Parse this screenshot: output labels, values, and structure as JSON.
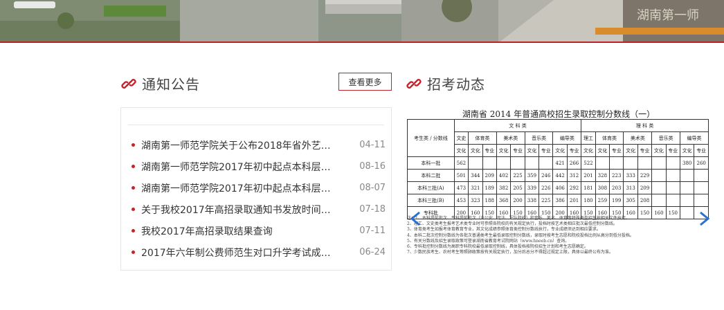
{
  "banner": {
    "sign_text": "湖南第一师"
  },
  "notice": {
    "title": "通知公告",
    "more_label": "查看更多",
    "items": [
      {
        "text": "湖南第一师范学院关于公布2018年省外艺术...",
        "date": "04-11"
      },
      {
        "text": "湖南第一师范学院2017年初中起点本科层次...",
        "date": "08-16"
      },
      {
        "text": "湖南第一师范学院2017年初中起点本科层次...",
        "date": "08-07"
      },
      {
        "text": "关于我校2017年高招录取通知书发放时间的...",
        "date": "07-18"
      },
      {
        "text": "我校2017年高招录取结果查询",
        "date": "07-11"
      },
      {
        "text": "2017年六年制公费师范生对口升学考试成绩...",
        "date": "06-24"
      }
    ]
  },
  "news": {
    "title": "招考动态",
    "slide": {
      "title": "湖南省 2014 年普通高校招生录取控制分数线（一）",
      "h_cat": "考生类",
      "h_line": "分数线",
      "h_batch": "批次",
      "h_wenke": "文 科 类",
      "h_like": "理 科 类",
      "sub_groups": [
        "文史",
        "体育类",
        "美术类",
        "音乐类",
        "编导类",
        "理工",
        "体育类",
        "美术类",
        "音乐类",
        "编导类"
      ],
      "sub_cols": [
        "文化",
        "文化",
        "专业",
        "文化",
        "专业",
        "文化",
        "专业",
        "文化",
        "专业",
        "文化",
        "文化",
        "专业",
        "文化",
        "专业",
        "文化",
        "专业",
        "文化",
        "专业"
      ],
      "rows": [
        {
          "label": "本科一批",
          "cells": [
            "562",
            "",
            "",
            "",
            "",
            "",
            "",
            "421",
            "266",
            "522",
            "",
            "",
            "",
            "",
            "",
            "",
            "380",
            "260"
          ]
        },
        {
          "label": "本科二批",
          "cells": [
            "501",
            "344",
            "209",
            "402",
            "225",
            "359",
            "246",
            "442",
            "312",
            "201",
            "328",
            "223",
            "333",
            "229",
            "",
            "",
            "",
            ""
          ]
        },
        {
          "label": "本科三批(A)",
          "cells": [
            "473",
            "321",
            "189",
            "382",
            "205",
            "339",
            "226",
            "406",
            "292",
            "181",
            "308",
            "203",
            "313",
            "209",
            "",
            "",
            "",
            ""
          ]
        },
        {
          "label": "本科三批(B)",
          "cells": [
            "453",
            "323",
            "188",
            "368",
            "200",
            "338",
            "225",
            "386",
            "201",
            "180",
            "259",
            "199",
            "305",
            "208",
            "",
            "",
            "",
            ""
          ]
        },
        {
          "label": "专科批",
          "cells": [
            "200",
            "160",
            "150",
            "160",
            "150",
            "160",
            "150",
            "200",
            "160",
            "150",
            "160",
            "150",
            "160",
            "150",
            "160",
            "150",
            "",
            ""
          ]
        }
      ],
      "notes": [
        "注：1、本科提前批次、专科提前批次（含公安、司法、军队院校）和音乐、美术、体育等特殊类型招生按相关文件执行。",
        "2、理工、文史类考生报考艺术类专业时可参照各院校的有关规定执行，投档时按艺术类相应批次最低控制分数线。",
        "3、体育类考生如报考体育教育专业，其文化成绩参照体育类控制分数线执行，专业成绩须达到相应要求。",
        "4、本科二批次控制分数线为各批次普通类考生最低录取控制分数线，录取时按考生志愿和院校投档比例从高分到低分投档。",
        "5、有关分数线及招生录取政策可登录湖南省教育考试院网站（www.hneeb.cn）查询。",
        "6、专科批控制分数线为高职专科院校最低录取控制线，具体投档按院校招生计划和考生志愿确定。",
        "7、少数民族考生、农村考生等照顾政策按有关规定执行，加分后总分不得超过规定上限，具体以最终公布为准。"
      ]
    }
  }
}
